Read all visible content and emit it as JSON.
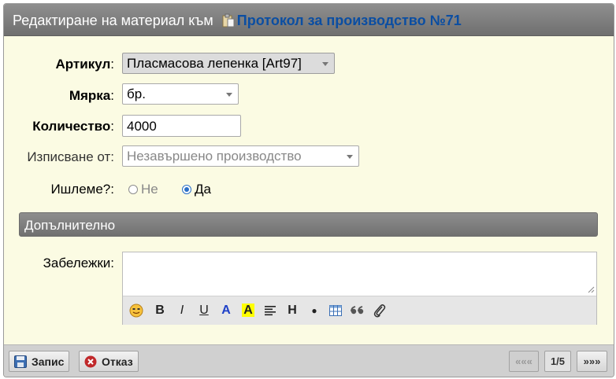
{
  "window": {
    "title_prefix": "Редактиране на материал към",
    "title_link": "Протокол за производство №71"
  },
  "form": {
    "article": {
      "label": "Артикул",
      "colon": ":",
      "value": "Пласмасова лепенка [Art97]"
    },
    "unit": {
      "label": "Мярка",
      "colon": ":",
      "value": "бр."
    },
    "quantity": {
      "label": "Количество",
      "colon": ":",
      "value": "4000"
    },
    "writeoff": {
      "label": "Изписване от:",
      "placeholder": "Незавършено производство"
    },
    "waste": {
      "label": "Ишлеме?:",
      "options": [
        {
          "label": "Не",
          "selected": false
        },
        {
          "label": "Да",
          "selected": true
        }
      ]
    }
  },
  "extra_section": {
    "title": "Допълнително"
  },
  "notes": {
    "label": "Забележки:",
    "value": "",
    "toolbar": {
      "smiley": "smiley-icon",
      "bold": "B",
      "italic": "I",
      "underline": "U",
      "text_color": "A",
      "highlight": "A",
      "align": "align-icon",
      "heading": "H",
      "bullet": "●",
      "table": "table-icon",
      "quote": "66",
      "attach": "paperclip-icon"
    }
  },
  "footer": {
    "save_label": "Запис",
    "cancel_label": "Отказ",
    "pager_prev": "«««",
    "pager_pos": "1/5",
    "pager_next": "»»»"
  },
  "colors": {
    "accent_link": "#0b4ea2",
    "panel_bg": "#fbfbe3",
    "header_gray": "#7f7f7f",
    "radio_selected": "#2a6fc7",
    "cancel_red": "#c0282a"
  }
}
